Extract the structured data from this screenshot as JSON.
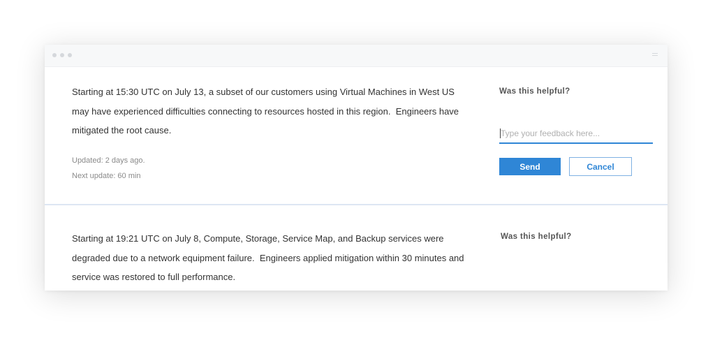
{
  "incidents": [
    {
      "message": "Starting at 15:30 UTC on July 13, a subset of our customers using Virtual Machines in West US may have experienced difficulties connecting to resources hosted in this region.  Engineers have mitigated the root cause.",
      "updated": "Updated:  2 days ago.",
      "next_update": "Next update: 60 min",
      "feedback": {
        "prompt": "Was this helpful?",
        "placeholder": "Type your feedback here...",
        "send_label": "Send",
        "cancel_label": "Cancel"
      }
    },
    {
      "message": "Starting at 19:21 UTC on July 8, Compute, Storage, Service Map, and Backup services were degraded due to a network equipment failure.  Engineers applied mitigation within 30 minutes and service was restored to full performance.",
      "feedback": {
        "prompt": "Was this helpful?",
        "icons": [
          "smile-icon",
          "frown-icon"
        ]
      }
    }
  ],
  "colors": {
    "accent": "#2f86d6",
    "text": "#333333",
    "muted": "#8a8a8a",
    "divider": "#dde6f3"
  }
}
